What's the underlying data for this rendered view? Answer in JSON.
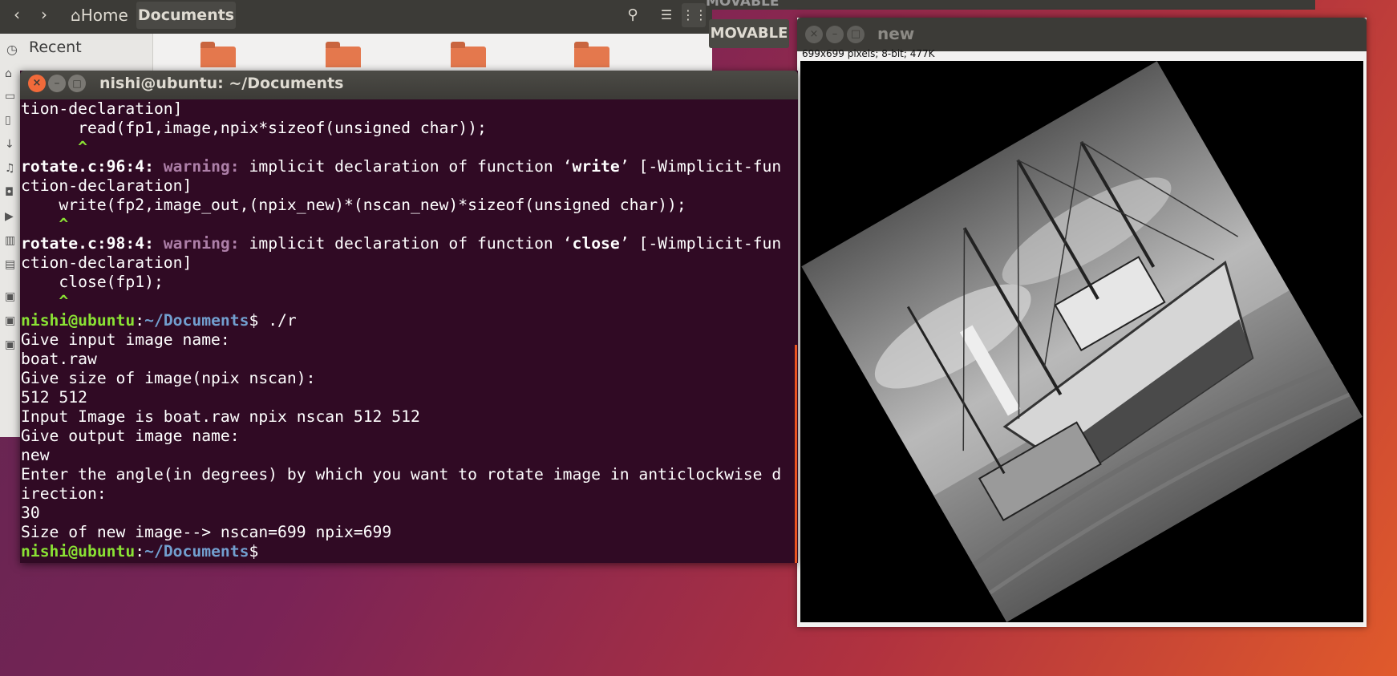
{
  "nautilus": {
    "home_label": "Home",
    "documents_label": "Documents",
    "sidebar_recent": "Recent"
  },
  "movable": {
    "ghost_label": "MOVABLE",
    "button_label": "MOVABLE"
  },
  "viewer": {
    "title": "new",
    "info": "699x699 pixels; 8-bit; 477K"
  },
  "terminal": {
    "title": "nishi@ubuntu: ~/Documents",
    "lines": {
      "l0": "tion-declaration]",
      "l1": "      read(fp1,image,npix*sizeof(unsigned char));",
      "l2": "      ^",
      "l3a": "rotate.c:96:4:",
      "l3b": " warning:",
      "l3c": " implicit declaration of function ‘",
      "l3d": "write",
      "l3e": "’ [-Wimplicit-fun",
      "l4": "ction-declaration]",
      "l5": "    write(fp2,image_out,(npix_new)*(nscan_new)*sizeof(unsigned char));",
      "l6": "    ^",
      "l7a": "rotate.c:98:4:",
      "l7b": " warning:",
      "l7c": " implicit declaration of function ‘",
      "l7d": "close",
      "l7e": "’ [-Wimplicit-fun",
      "l8": "ction-declaration]",
      "l9": "    close(fp1);",
      "l10": "    ^",
      "l11a": "nishi@ubuntu",
      "l11b": ":",
      "l11c": "~/Documents",
      "l11d": "$ ./r",
      "l12": "Give input image name:",
      "l13": "boat.raw",
      "l14": "Give size of image(npix nscan):",
      "l15": "512 512",
      "l16": "Input Image is boat.raw npix nscan 512 512",
      "l17": "Give output image name:",
      "l18": "new",
      "l19": "Enter the angle(in degrees) by which you want to rotate image in anticlockwise d",
      "l20": "irection:",
      "l21": "30",
      "l22": "Size of new image--> nscan=699 npix=699",
      "l23a": "nishi@ubuntu",
      "l23b": ":",
      "l23c": "~/Documents",
      "l23d": "$"
    }
  },
  "icons": {
    "back": "‹",
    "forward": "›",
    "home": "⌂",
    "search": "⚲",
    "list": "☰",
    "grid": "⋮⋮",
    "close": "×",
    "minimize": "–",
    "maximize": "□",
    "recent": "◷"
  },
  "colors": {
    "terminal_bg": "#300a24",
    "prompt_user": "#8ae234",
    "prompt_path": "#729fcf",
    "warning": "#ad7fa8",
    "close_button": "#f16a3a"
  }
}
